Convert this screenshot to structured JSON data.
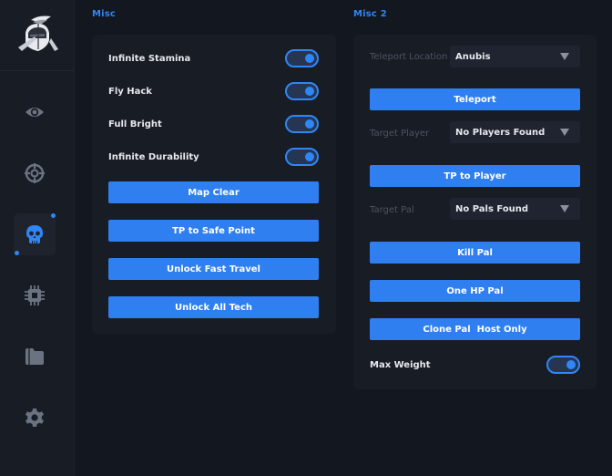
{
  "sidebar": {
    "items": [
      {
        "icon": "eye-icon"
      },
      {
        "icon": "crosshair-icon"
      },
      {
        "icon": "skull-icon",
        "active": true
      },
      {
        "icon": "chip-icon"
      },
      {
        "icon": "folder-icon"
      },
      {
        "icon": "gear-icon"
      }
    ]
  },
  "colors": {
    "accent": "#2f86f6",
    "panel": "#181c25",
    "background": "#131720"
  },
  "misc": {
    "title": "Misc",
    "toggles": [
      {
        "label": "Infinite Stamina",
        "on": true
      },
      {
        "label": "Fly Hack",
        "on": true
      },
      {
        "label": "Full Bright",
        "on": true
      },
      {
        "label": "Infinite Durability",
        "on": true
      }
    ],
    "buttons": [
      "Map Clear",
      "TP to Safe Point",
      "Unlock Fast Travel",
      "Unlock All Tech"
    ]
  },
  "misc2": {
    "title": "Misc 2",
    "teleport_location": {
      "label": "Teleport Location",
      "value": "Anubis"
    },
    "teleport_button": "Teleport",
    "target_player": {
      "label": "Target Player",
      "value": "No Players Found"
    },
    "tp_player_button": "TP to Player",
    "target_pal": {
      "label": "Target Pal",
      "value": "No Pals Found"
    },
    "pal_buttons": [
      "Kill Pal",
      "One HP Pal",
      "Clone Pal  Host Only"
    ],
    "max_weight": {
      "label": "Max Weight",
      "on": true
    }
  }
}
